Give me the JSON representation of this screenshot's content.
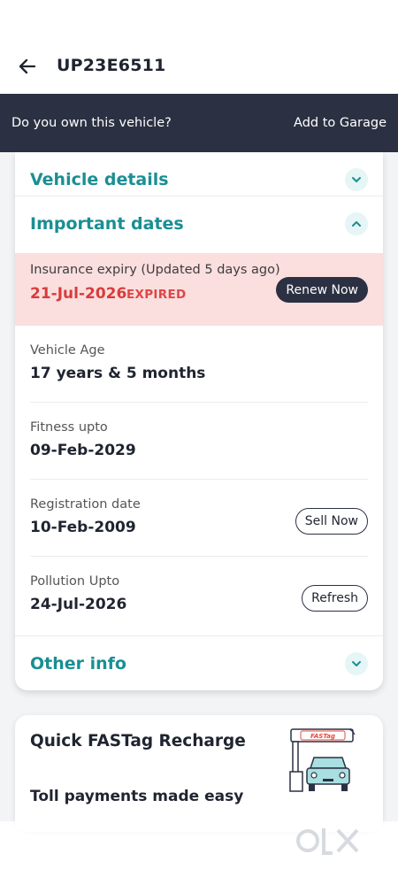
{
  "header": {
    "title": "UP23E6511",
    "back_icon": "arrow-left-icon"
  },
  "banner": {
    "question": "Do you own this vehicle?",
    "action": "Add to Garage"
  },
  "sections": {
    "vehicle_details": {
      "label": "Vehicle details",
      "icon": "chevron-down-icon"
    },
    "important_dates": {
      "label": "Important dates",
      "icon": "chevron-up-icon"
    },
    "other_info": {
      "label": "Other info",
      "icon": "chevron-down-icon"
    }
  },
  "insurance": {
    "label": "Insurance expiry (Updated 5 days ago)",
    "date": "21-Jul-2026",
    "status": "EXPIRED",
    "button": "Renew Now"
  },
  "rows": [
    {
      "label": "Vehicle Age",
      "value": "17 years & 5 months",
      "button": null
    },
    {
      "label": "Fitness upto",
      "value": "09-Feb-2029",
      "button": null
    },
    {
      "label": "Registration date",
      "value": "10-Feb-2009",
      "button": "Sell Now"
    },
    {
      "label": "Pollution Upto",
      "value": "24-Jul-2026",
      "button": "Refresh"
    }
  ],
  "fastag": {
    "title": "Quick FASTag Recharge",
    "subtitle": "Toll payments made easy",
    "illustration_icon": "toll-booth-car-icon"
  },
  "watermark": {
    "brand": "OLX",
    "icon": "olx-logo-icon"
  },
  "colors": {
    "accent": "#1a8f93",
    "dark": "#2b3142",
    "expired_bg": "#fbdede",
    "expired_text": "#d93b3b"
  }
}
